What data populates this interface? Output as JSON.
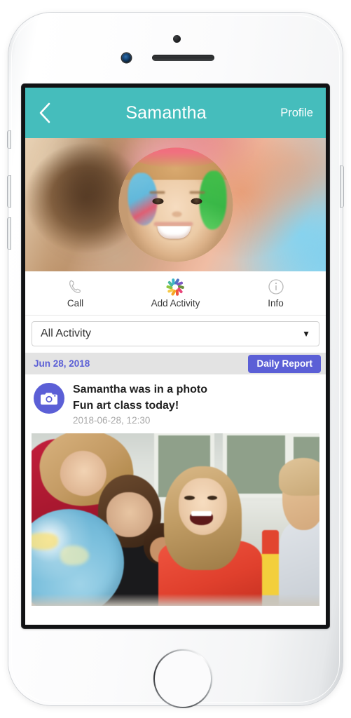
{
  "device": {
    "name": "white-iphone",
    "hardware": {
      "earpiece_speaker": "earpiece-speaker",
      "front_camera": "front-camera-icon",
      "proximity_sensor": "proximity-sensor-icon",
      "home_button": "home-button",
      "power_button": "power-button",
      "volume_up_button": "volume-up-button",
      "volume_down_button": "volume-down-button",
      "silent_switch": "silent-switch"
    }
  },
  "colors": {
    "header_teal": "#45bdbc",
    "accent_purple": "#5b5fd6",
    "date_bar_gray": "#e3e3e3",
    "timestamp_gray": "#a8a8a8",
    "body_text": "#1f1f1f"
  },
  "header": {
    "back_icon": "chevron-left-icon",
    "title": "Samantha",
    "profile_label": "Profile"
  },
  "hero": {
    "cover_photo_alt": "blurred classroom background",
    "avatar_alt": "smiling girl with blue and green face paint"
  },
  "actions": [
    {
      "icon": "phone-icon",
      "label": "Call"
    },
    {
      "icon": "pinwheel-icon",
      "label": "Add Activity"
    },
    {
      "icon": "info-icon",
      "label": "Info"
    }
  ],
  "pinwheel_colors": [
    "#8ec63f",
    "#4ab8a1",
    "#3bb6c9",
    "#4f72c4",
    "#7e57c2",
    "#6b8f3e",
    "#e8447a",
    "#f0523b",
    "#f5a623",
    "#f7c948"
  ],
  "filter": {
    "label": "All Activity",
    "placeholder": "All Activity",
    "caret_icon": "chevron-down-icon",
    "options": [
      "All Activity"
    ]
  },
  "date_bar": {
    "date": "Jun 28, 2018",
    "report_button": "Daily Report"
  },
  "activity": {
    "icon": "camera-icon",
    "title": "Samantha was in a photo",
    "caption": "Fun art class today!",
    "timestamp": "2018-06-28, 12:30",
    "photo_alt": "children in classroom looking at a globe"
  }
}
